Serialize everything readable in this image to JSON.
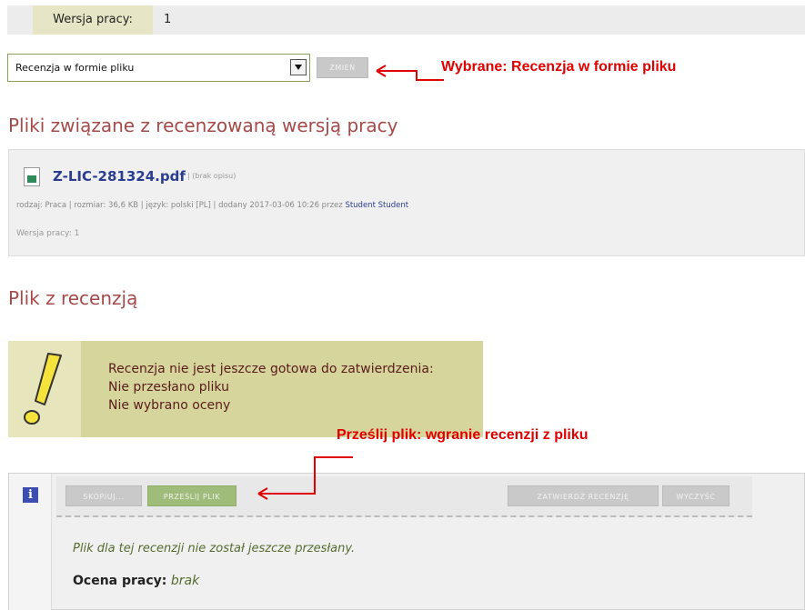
{
  "version_row": {
    "label": "Wersja pracy:",
    "value": "1"
  },
  "review_type": {
    "selected": "Recenzja w formie pliku",
    "change_label": "ZMIEŃ"
  },
  "annotations": {
    "selected_note": "Wybrane: Recenzja w formie pliku",
    "upload_note": "Prześlij plik: wgranie recenzji z pliku"
  },
  "files_section": {
    "heading": "Pliki związane z recenzowaną wersją pracy",
    "file": {
      "name": "Z-LIC-281324.pdf",
      "description": "| (brak opisu)",
      "meta": "rodzaj: Praca | rozmiar: 36,6 KB | język: polski [PL] | dodany 2017-03-06 10:26 przez",
      "author": "Student Student",
      "version": "Wersja pracy: 1"
    }
  },
  "review_section": {
    "heading": "Plik z recenzją",
    "warning": {
      "line1": "Recenzja nie jest jeszcze gotowa do zatwierdzenia:",
      "line2": "Nie przesłano pliku",
      "line3": "Nie wybrano oceny"
    },
    "toolbar": {
      "copy_label": "SKOPIUJ...",
      "upload_label": "PRZEŚLIJ PLIK",
      "approve_label": "ZATWIERDŹ RECENZJĘ",
      "clear_label": "WYCZYŚĆ"
    },
    "not_uploaded_text": "Plik dla tej recenzji nie został jeszcze przesłany.",
    "grade_label": "Ocena pracy:",
    "grade_value": "brak"
  },
  "colors": {
    "heading": "#a54a4a",
    "annotation": "#e00000",
    "warning_bg": "#d6d59c",
    "upload_button": "#9fbc7a",
    "link": "#2a3d8f"
  },
  "icons": [
    "chevron-down-icon",
    "pdf-file-icon",
    "exclamation-icon",
    "info-icon",
    "arrow-left-icon"
  ]
}
